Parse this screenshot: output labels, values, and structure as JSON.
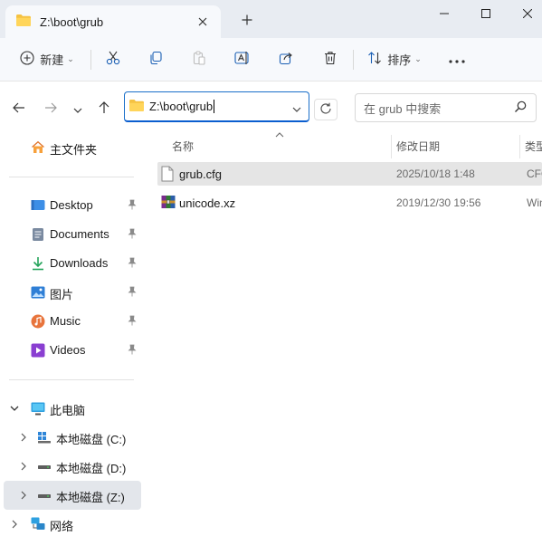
{
  "window": {
    "tab_title": "Z:\\boot\\grub"
  },
  "toolbar": {
    "new_label": "新建",
    "sort_label": "排序"
  },
  "address": {
    "path": "Z:\\boot\\grub",
    "search_placeholder": "在 grub 中搜索"
  },
  "sidebar": {
    "home": "主文件夹",
    "quick_access": [
      {
        "label": "Desktop",
        "icon": "desktop-icon"
      },
      {
        "label": "Documents",
        "icon": "documents-icon"
      },
      {
        "label": "Downloads",
        "icon": "downloads-icon"
      },
      {
        "label": "图片",
        "icon": "pictures-icon"
      },
      {
        "label": "Music",
        "icon": "music-icon"
      },
      {
        "label": "Videos",
        "icon": "videos-icon"
      }
    ],
    "this_pc": "此电脑",
    "drives": [
      {
        "label": "本地磁盘 (C:)"
      },
      {
        "label": "本地磁盘 (D:)"
      },
      {
        "label": "本地磁盘 (Z:)"
      }
    ],
    "network": "网络"
  },
  "columns": {
    "name": "名称",
    "modified": "修改日期",
    "type": "类型"
  },
  "files": [
    {
      "name": "grub.cfg",
      "modified": "2025/10/18 1:48",
      "type": "CFG"
    },
    {
      "name": "unicode.xz",
      "modified": "2019/12/30 19:56",
      "type": "Win"
    }
  ],
  "colors": {
    "accent": "#0b5ecf",
    "titlebar": "#e8ecf2",
    "selection": "#e5e5e5"
  }
}
